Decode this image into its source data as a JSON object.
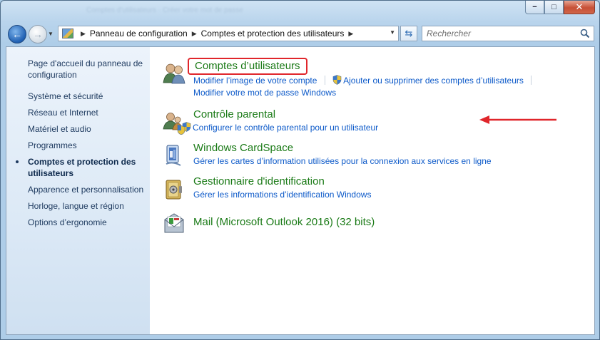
{
  "window": {
    "title_blurred": "Comptes d'utilisateurs · Créer votre mot de passe",
    "caption": {
      "minimize": "−",
      "maximize": "□",
      "close": "✕"
    }
  },
  "address": {
    "crumbs": [
      "Panneau de configuration",
      "Comptes et protection des utilisateurs"
    ],
    "search_placeholder": "Rechercher"
  },
  "sidebar": {
    "home": "Page d'accueil du panneau de configuration",
    "items": [
      "Système et sécurité",
      "Réseau et Internet",
      "Matériel et audio",
      "Programmes",
      "Comptes et protection des utilisateurs",
      "Apparence et personnalisation",
      "Horloge, langue et région",
      "Options d’ergonomie"
    ],
    "current_index": 4
  },
  "categories": [
    {
      "title": "Comptes d’utilisateurs",
      "icon": "user-accounts-icon",
      "highlighted": true,
      "links": [
        "Modifier l’image de votre compte",
        "Ajouter ou supprimer des comptes d’utilisateurs",
        "Modifier votre mot de passe Windows"
      ]
    },
    {
      "title": "Contrôle parental",
      "icon": "parental-control-icon",
      "links": [
        "Configurer le contrôle parental pour un utilisateur"
      ]
    },
    {
      "title": "Windows CardSpace",
      "icon": "cardspace-icon",
      "links": [
        "Gérer les cartes d’information utilisées pour la connexion aux services en ligne"
      ]
    },
    {
      "title": "Gestionnaire d'identification",
      "icon": "credential-manager-icon",
      "links": [
        "Gérer les informations d’identification Windows"
      ]
    },
    {
      "title": "Mail (Microsoft Outlook 2016) (32 bits)",
      "icon": "mail-icon",
      "links": []
    }
  ],
  "colors": {
    "category_title": "#1a7a16",
    "link": "#0d5ac9",
    "highlight": "#e0262b"
  }
}
